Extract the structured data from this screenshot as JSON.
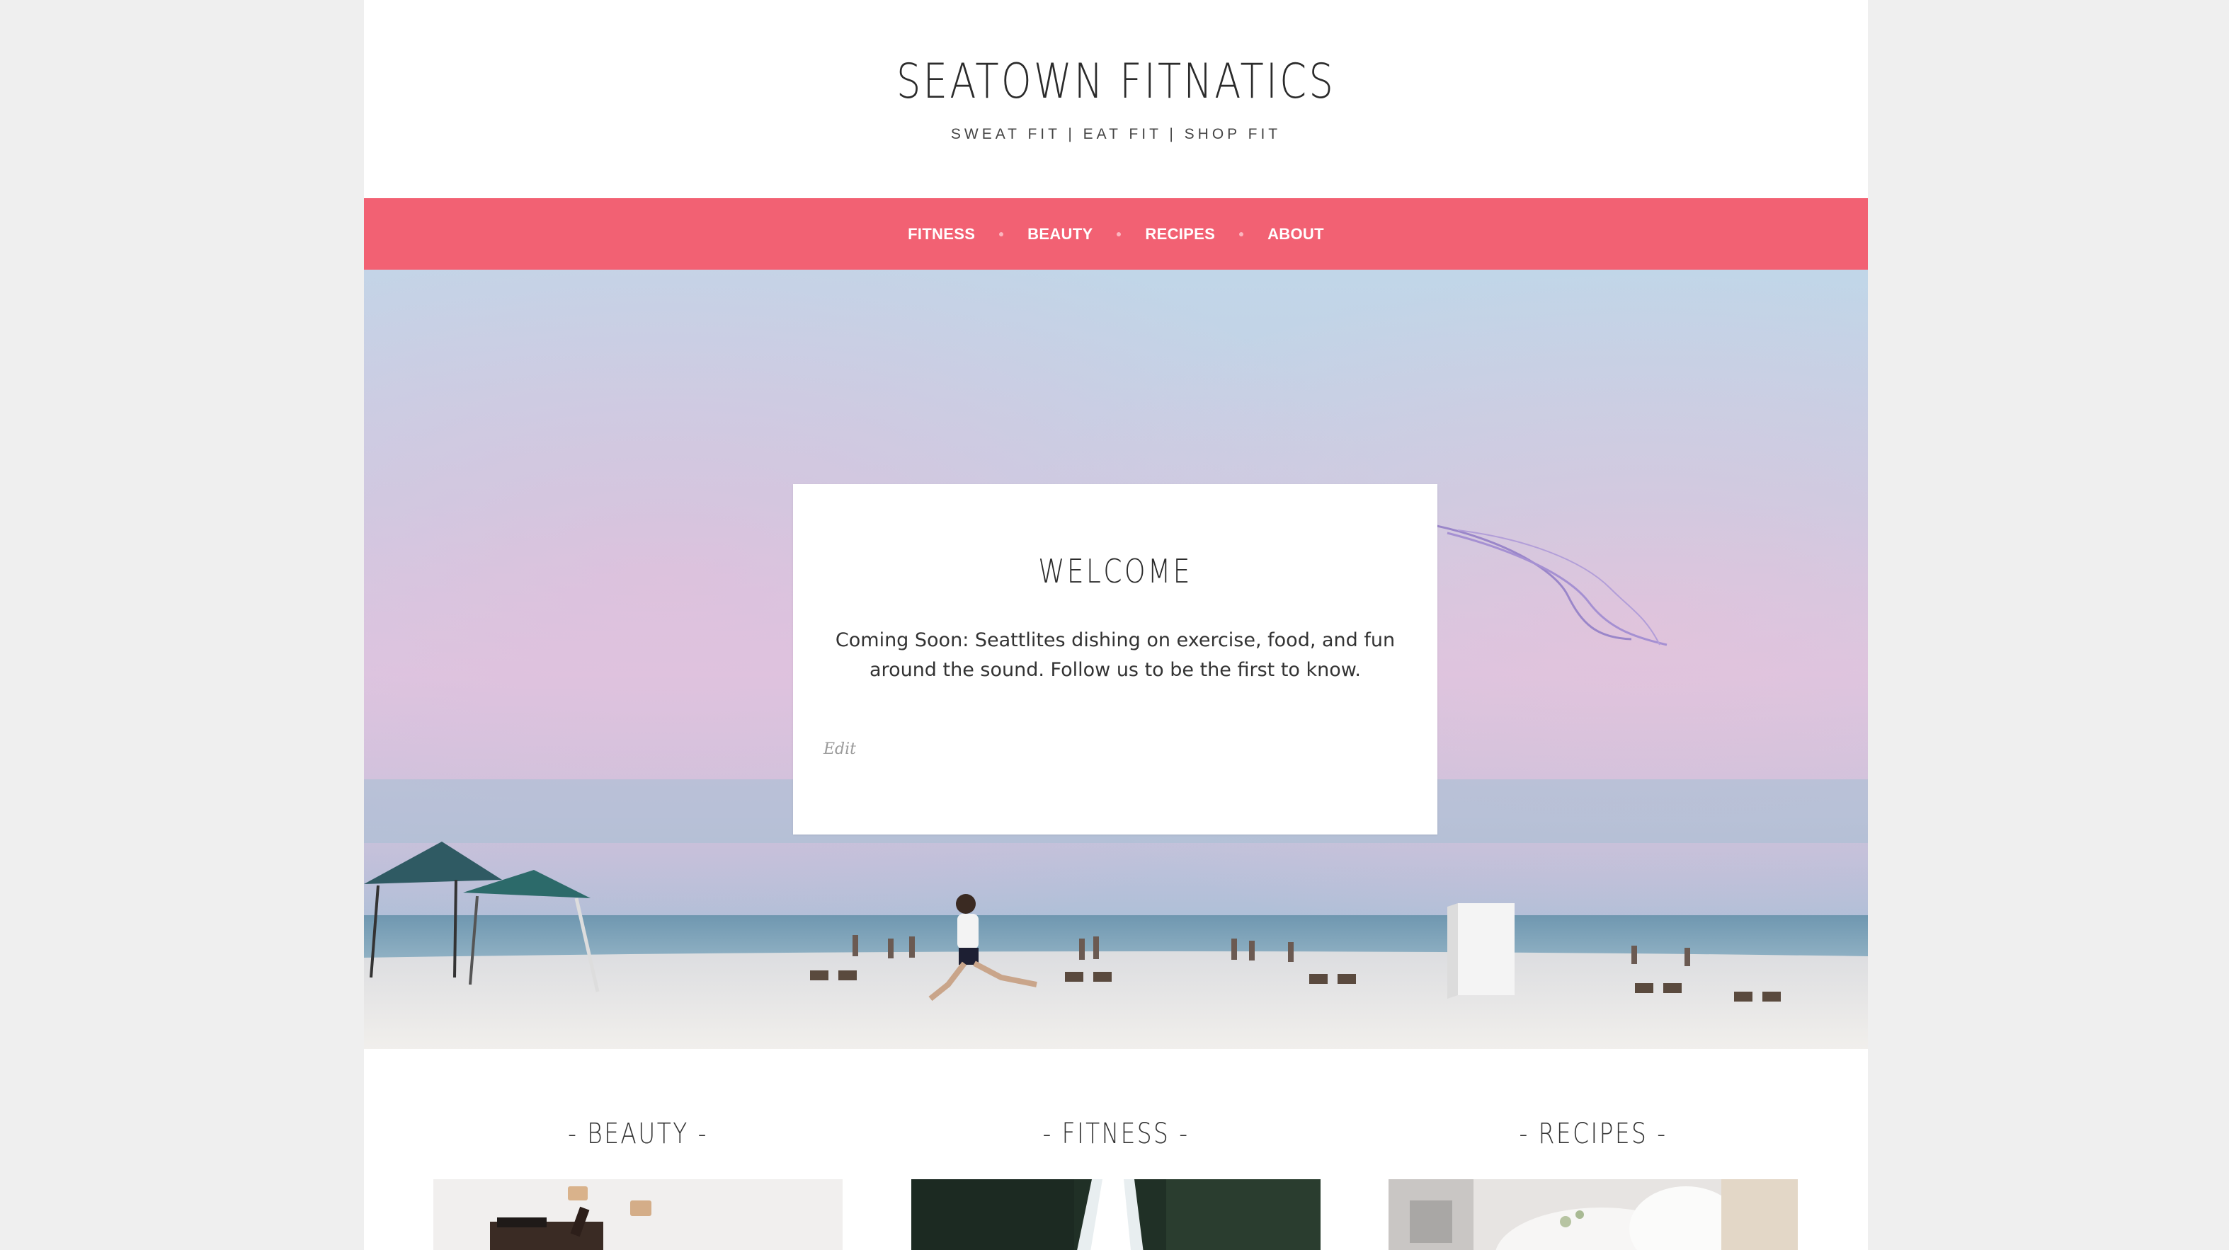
{
  "site": {
    "title": "SEATOWN FITNATICS",
    "tagline": "SWEAT FIT | EAT FIT | SHOP FIT"
  },
  "nav": {
    "items": [
      {
        "label": "FITNESS"
      },
      {
        "label": "BEAUTY"
      },
      {
        "label": "RECIPES"
      },
      {
        "label": "ABOUT"
      }
    ],
    "background": "#f26173"
  },
  "welcome": {
    "title": "WELCOME",
    "text": "Coming Soon: Seattlites dishing on exercise, food, and fun around the sound. Follow us to be the first to know.",
    "edit_label": "Edit"
  },
  "categories": [
    {
      "title": "- BEAUTY -"
    },
    {
      "title": "- FITNESS -"
    },
    {
      "title": "- RECIPES -"
    }
  ]
}
